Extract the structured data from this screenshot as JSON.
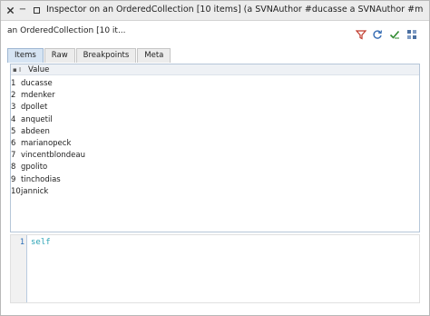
{
  "window": {
    "title": "Inspector on an OrderedCollection [10 items] (a SVNAuthor #ducasse a SVNAuthor #mdenk",
    "close_glyph": "×",
    "minimize_glyph": "−"
  },
  "header": {
    "object_label": "an OrderedCollection [10 it...",
    "tools": [
      {
        "icon": "filter-icon",
        "color": "#c0392b"
      },
      {
        "icon": "refresh-icon",
        "color": "#3a6fb5"
      },
      {
        "icon": "accept-check-icon",
        "color": "#2f8a2f"
      },
      {
        "icon": "browse-grid-icon",
        "color": "#4a6fa0"
      }
    ]
  },
  "tabs": [
    {
      "label": "Items",
      "active": true
    },
    {
      "label": "Raw",
      "active": false
    },
    {
      "label": "Breakpoints",
      "active": false
    },
    {
      "label": "Meta",
      "active": false
    }
  ],
  "list": {
    "index_header": "▪ I",
    "value_header": "Value",
    "rows": [
      {
        "index": "1",
        "value": "ducasse"
      },
      {
        "index": "2",
        "value": "mdenker"
      },
      {
        "index": "3",
        "value": "dpollet"
      },
      {
        "index": "4",
        "value": "anquetil"
      },
      {
        "index": "5",
        "value": "abdeen"
      },
      {
        "index": "6",
        "value": "marianopeck"
      },
      {
        "index": "7",
        "value": "vincentblondeau"
      },
      {
        "index": "8",
        "value": "gpolito"
      },
      {
        "index": "9",
        "value": "tinchodias"
      },
      {
        "index": "10",
        "value": "jannick"
      }
    ]
  },
  "code_pane": {
    "line_number": "1",
    "code": "self"
  },
  "colors": {
    "active_tab": "#d6e4f3",
    "code_text": "#2aa3b5",
    "line_number": "#2d6fb8"
  }
}
